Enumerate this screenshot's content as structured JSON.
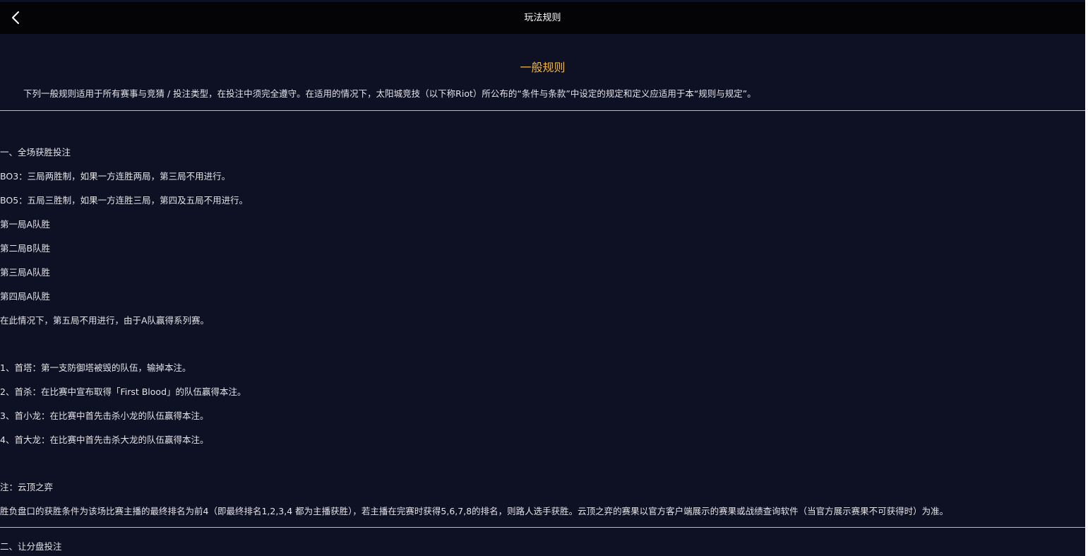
{
  "header": {
    "title": "玩法规则",
    "back_icon": "chevron-left-icon"
  },
  "section": {
    "title": "一般规则",
    "intro": "下列一般规则适用于所有赛事与竞猜 / 投注类型，在投注中须完全遵守。在适用的情况下，太阳城竞技（以下称Riot）所公布的“条件与条款”中设定的规定和定义应适用于本“规则与规定”。"
  },
  "rules": {
    "win_heading": "一、全场获胜投注",
    "bo3": "BO3：三局两胜制，如果一方连胜两局，第三局不用进行。",
    "bo5": "BO5：五局三胜制，如果一方连胜三局，第四及五局不用进行。",
    "game1": "第一局A队胜",
    "game2": "第二局B队胜",
    "game3": "第三局A队胜",
    "game4": "第四局A队胜",
    "conclusion": "在此情况下，第五局不用进行，由于A队赢得系列赛。",
    "first_tower": "1、首塔：第一支防御塔被毁的队伍，输掉本注。",
    "first_blood": "2、首杀：在比赛中宣布取得「First Blood」的队伍赢得本注。",
    "first_dragon": "3、首小龙：在比赛中首先击杀小龙的队伍赢得本注。",
    "first_baron": "4、首大龙：在比赛中首先击杀大龙的队伍赢得本注。",
    "note_heading": "注：云顶之弈",
    "note_body": "胜负盘口的获胜条件为该场比赛主播的最终排名为前4（即最终排名1,2,3,4 都为主播获胜），若主播在完赛时获得5,6,7,8的排名，则路人选手获胜。云顶之弈的赛果以官方客户端展示的赛果或战绩查询软件（当官方展示赛果不可获得时）为准。",
    "handicap_heading": "二、让分盘投注"
  },
  "colors": {
    "background": "#0e1024",
    "topbar": "#040406",
    "accent": "#f0b43a",
    "text": "#e3e3e8",
    "divider": "#b9bac6"
  }
}
